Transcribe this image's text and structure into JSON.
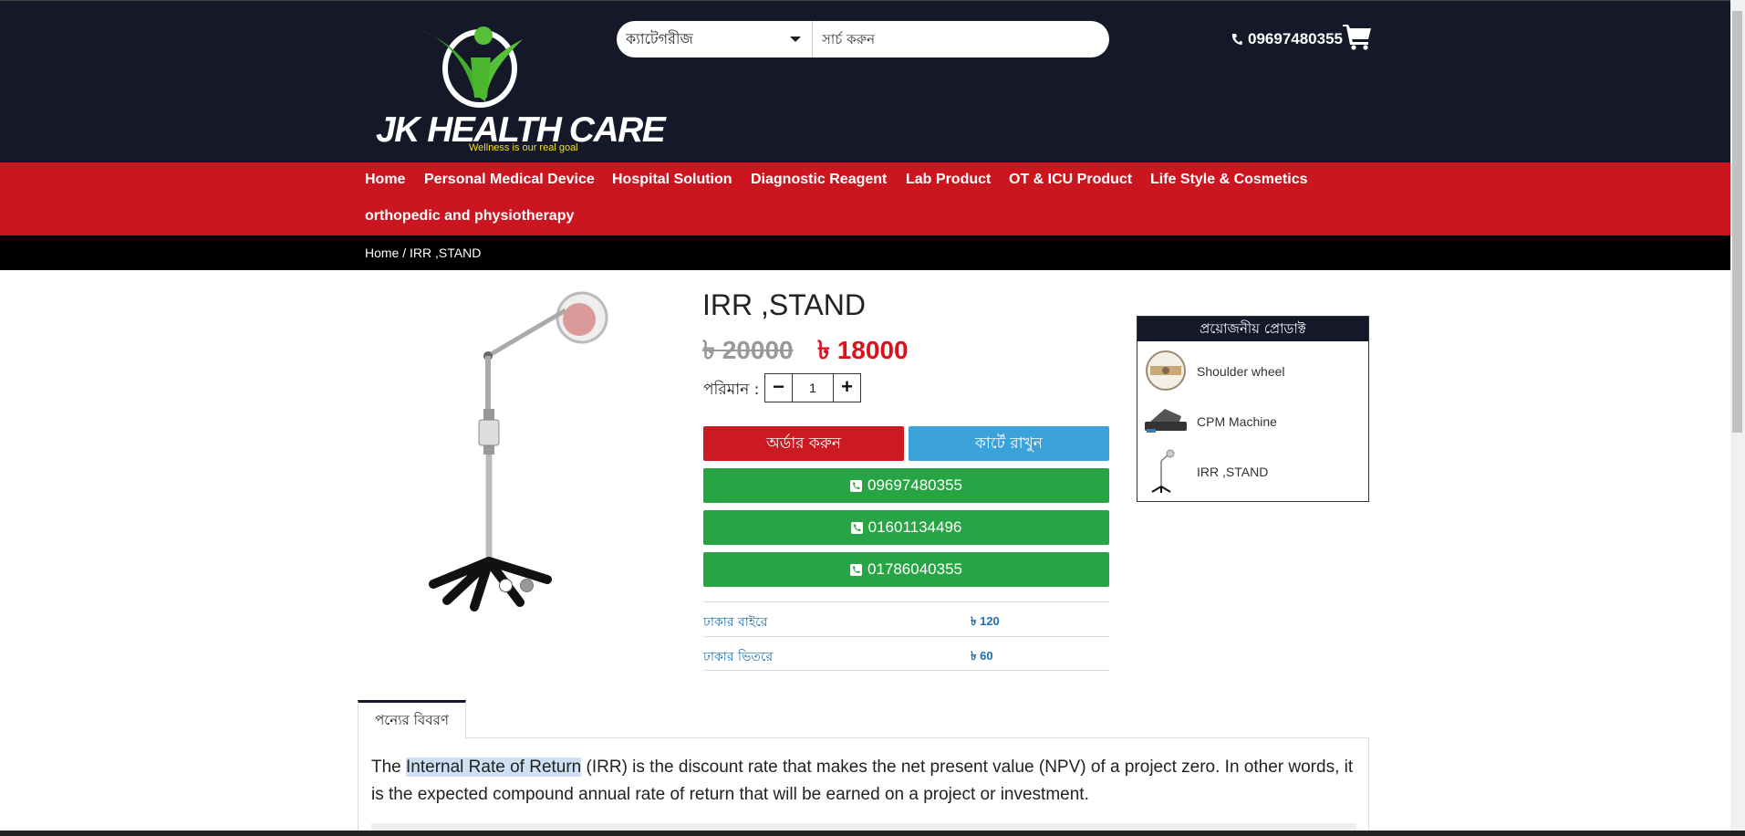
{
  "brand": {
    "name": "JK HEALTH CARE",
    "tagline": "Wellness is our real goal",
    "primary_color": "#141828",
    "nav_color": "#cb1620"
  },
  "header": {
    "category_select": "ক্যাটেগরীজ",
    "search_placeholder": "সার্চ করুন",
    "phone": "09697480355"
  },
  "nav": {
    "items": [
      "Home",
      "Personal Medical Device",
      "Hospital Solution",
      "Diagnostic Reagent",
      "Lab Product",
      "OT & ICU Product",
      "Life Style & Cosmetics",
      "orthopedic and physiotherapy"
    ]
  },
  "breadcrumb": {
    "home": "Home",
    "separator": " / ",
    "current": "IRR ,STAND"
  },
  "product": {
    "title": "IRR ,STAND",
    "old_price": "৳ 20000",
    "new_price": "৳ 18000",
    "qty_label": "পরিমান :",
    "qty": "1",
    "qty_minus": "−",
    "qty_plus": "+",
    "order_label": "অর্ডার করুন",
    "cart_label": "কার্টে রাখুন",
    "call_numbers": [
      "09697480355",
      "01601134496",
      "01786040355"
    ],
    "shipping": [
      {
        "label": "ঢাকার বাইরে",
        "value": "৳ 120"
      },
      {
        "label": "ঢাকার ভিতরে",
        "value": "৳ 60"
      }
    ]
  },
  "related": {
    "title": "প্রয়োজনীয় প্রোডাক্ট",
    "items": [
      "Shoulder wheel",
      "CPM Machine",
      "IRR ,STAND"
    ]
  },
  "tabs": {
    "description_tab": "পন্যের বিবরণ"
  },
  "description": {
    "prefix": "The ",
    "highlight": "Internal Rate of Return",
    "rest": " (IRR) is the discount rate that makes the net present value (NPV) of a project zero. In other words, it is the expected compound annual rate of return that will be earned on a project or investment."
  }
}
